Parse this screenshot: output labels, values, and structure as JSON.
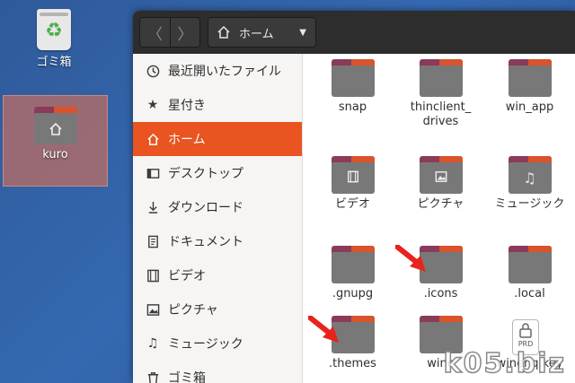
{
  "desktop": {
    "trash_label": "ゴミ箱",
    "home_label": "kuro"
  },
  "header": {
    "back_symbol": "〈",
    "forward_symbol": "〉",
    "path_label": "ホーム",
    "dropdown_symbol": "▼"
  },
  "sidebar": {
    "items": [
      {
        "label": "最近開いたファイル",
        "icon": "clock-icon"
      },
      {
        "label": "星付き",
        "icon": "star-icon"
      },
      {
        "label": "ホーム",
        "icon": "home-icon"
      },
      {
        "label": "デスクトップ",
        "icon": "desktop-icon"
      },
      {
        "label": "ダウンロード",
        "icon": "download-icon"
      },
      {
        "label": "ドキュメント",
        "icon": "document-icon"
      },
      {
        "label": "ビデオ",
        "icon": "video-icon"
      },
      {
        "label": "ピクチャ",
        "icon": "picture-icon"
      },
      {
        "label": "ミュージック",
        "icon": "music-icon"
      },
      {
        "label": "ゴミ箱",
        "icon": "trash-icon"
      }
    ]
  },
  "files": [
    {
      "name": "snap",
      "emblem": ""
    },
    {
      "name": "thinclient_\ndrives",
      "emblem": ""
    },
    {
      "name": "win_app",
      "emblem": ""
    },
    {
      "name": "ビデオ",
      "emblem": "film-icon"
    },
    {
      "name": "ピクチャ",
      "emblem": "picture-icon"
    },
    {
      "name": "ミュージック",
      "emblem": "music-note-icon"
    },
    {
      "name": ".gnupg",
      "emblem": ""
    },
    {
      "name": ".icons",
      "emblem": ""
    },
    {
      "name": ".local",
      "emblem": ""
    },
    {
      "name": ".themes",
      "emblem": ""
    },
    {
      "name": "wine",
      "emblem": ""
    },
    {
      "name": "winehq.key",
      "emblem": ""
    }
  ],
  "lock_badge_text": "PRD",
  "watermark": "k05.biz",
  "colors": {
    "accent": "#e95420",
    "arrow": "#e8231b",
    "header": "#2d2d2d"
  }
}
